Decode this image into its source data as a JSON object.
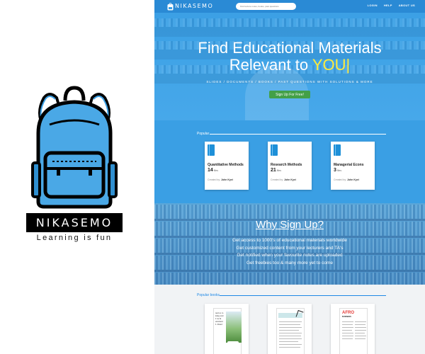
{
  "brand": {
    "name": "NIKASEMO",
    "tagline": "Learning is fun",
    "accent": "#3a9fe4"
  },
  "site": {
    "nav": {
      "logo_text": "NIKASEMO",
      "search_placeholder": "Find lecture notes, books, past questions",
      "links": [
        "LOGIN",
        "HELP",
        "ABOUT US"
      ]
    },
    "hero": {
      "title_line1": "Find Educational Materials",
      "title_line2_prefix": "Relevant to ",
      "title_line2_highlight": "YOU|",
      "subtitle": "SLIDES / DOCUMENTS / BOOKS / PAST QUESTIONS WITH SOLUTIONS & MORE",
      "cta_label": "Sign Up For Free!",
      "highlight_color": "#ffeb3b",
      "cta_color": "#43a047"
    },
    "popular": {
      "title": "Popular",
      "cards": [
        {
          "title": "Quantitative Methods",
          "count": "14",
          "unit": "files",
          "created_label": "Created by:",
          "author": "John Kyei"
        },
        {
          "title": "Research Methods",
          "count": "21",
          "unit": "files",
          "created_label": "Created by:",
          "author": "John Kyei"
        },
        {
          "title": "Managerial Econs",
          "count": "3",
          "unit": "files",
          "created_label": "Created by:",
          "author": "John Kyei"
        }
      ]
    },
    "why": {
      "title": "Why Sign Up?",
      "items": [
        "Get access to 1000's of educational materials worldwide",
        "Get customized content from your lecturers and TA's",
        "Get notified when your favourite notes are uploaded",
        "Get freebies too & many more yet to come"
      ]
    },
    "books": {
      "title": "Popular books",
      "book1_title_lines": [
        "nertos to",
        "king and",
        "I local",
        "ernment",
        "",
        "L Ruud"
      ],
      "book3_logo_prefix": "AFRO",
      "book3_logo_suffix": "BUSINESS"
    }
  }
}
